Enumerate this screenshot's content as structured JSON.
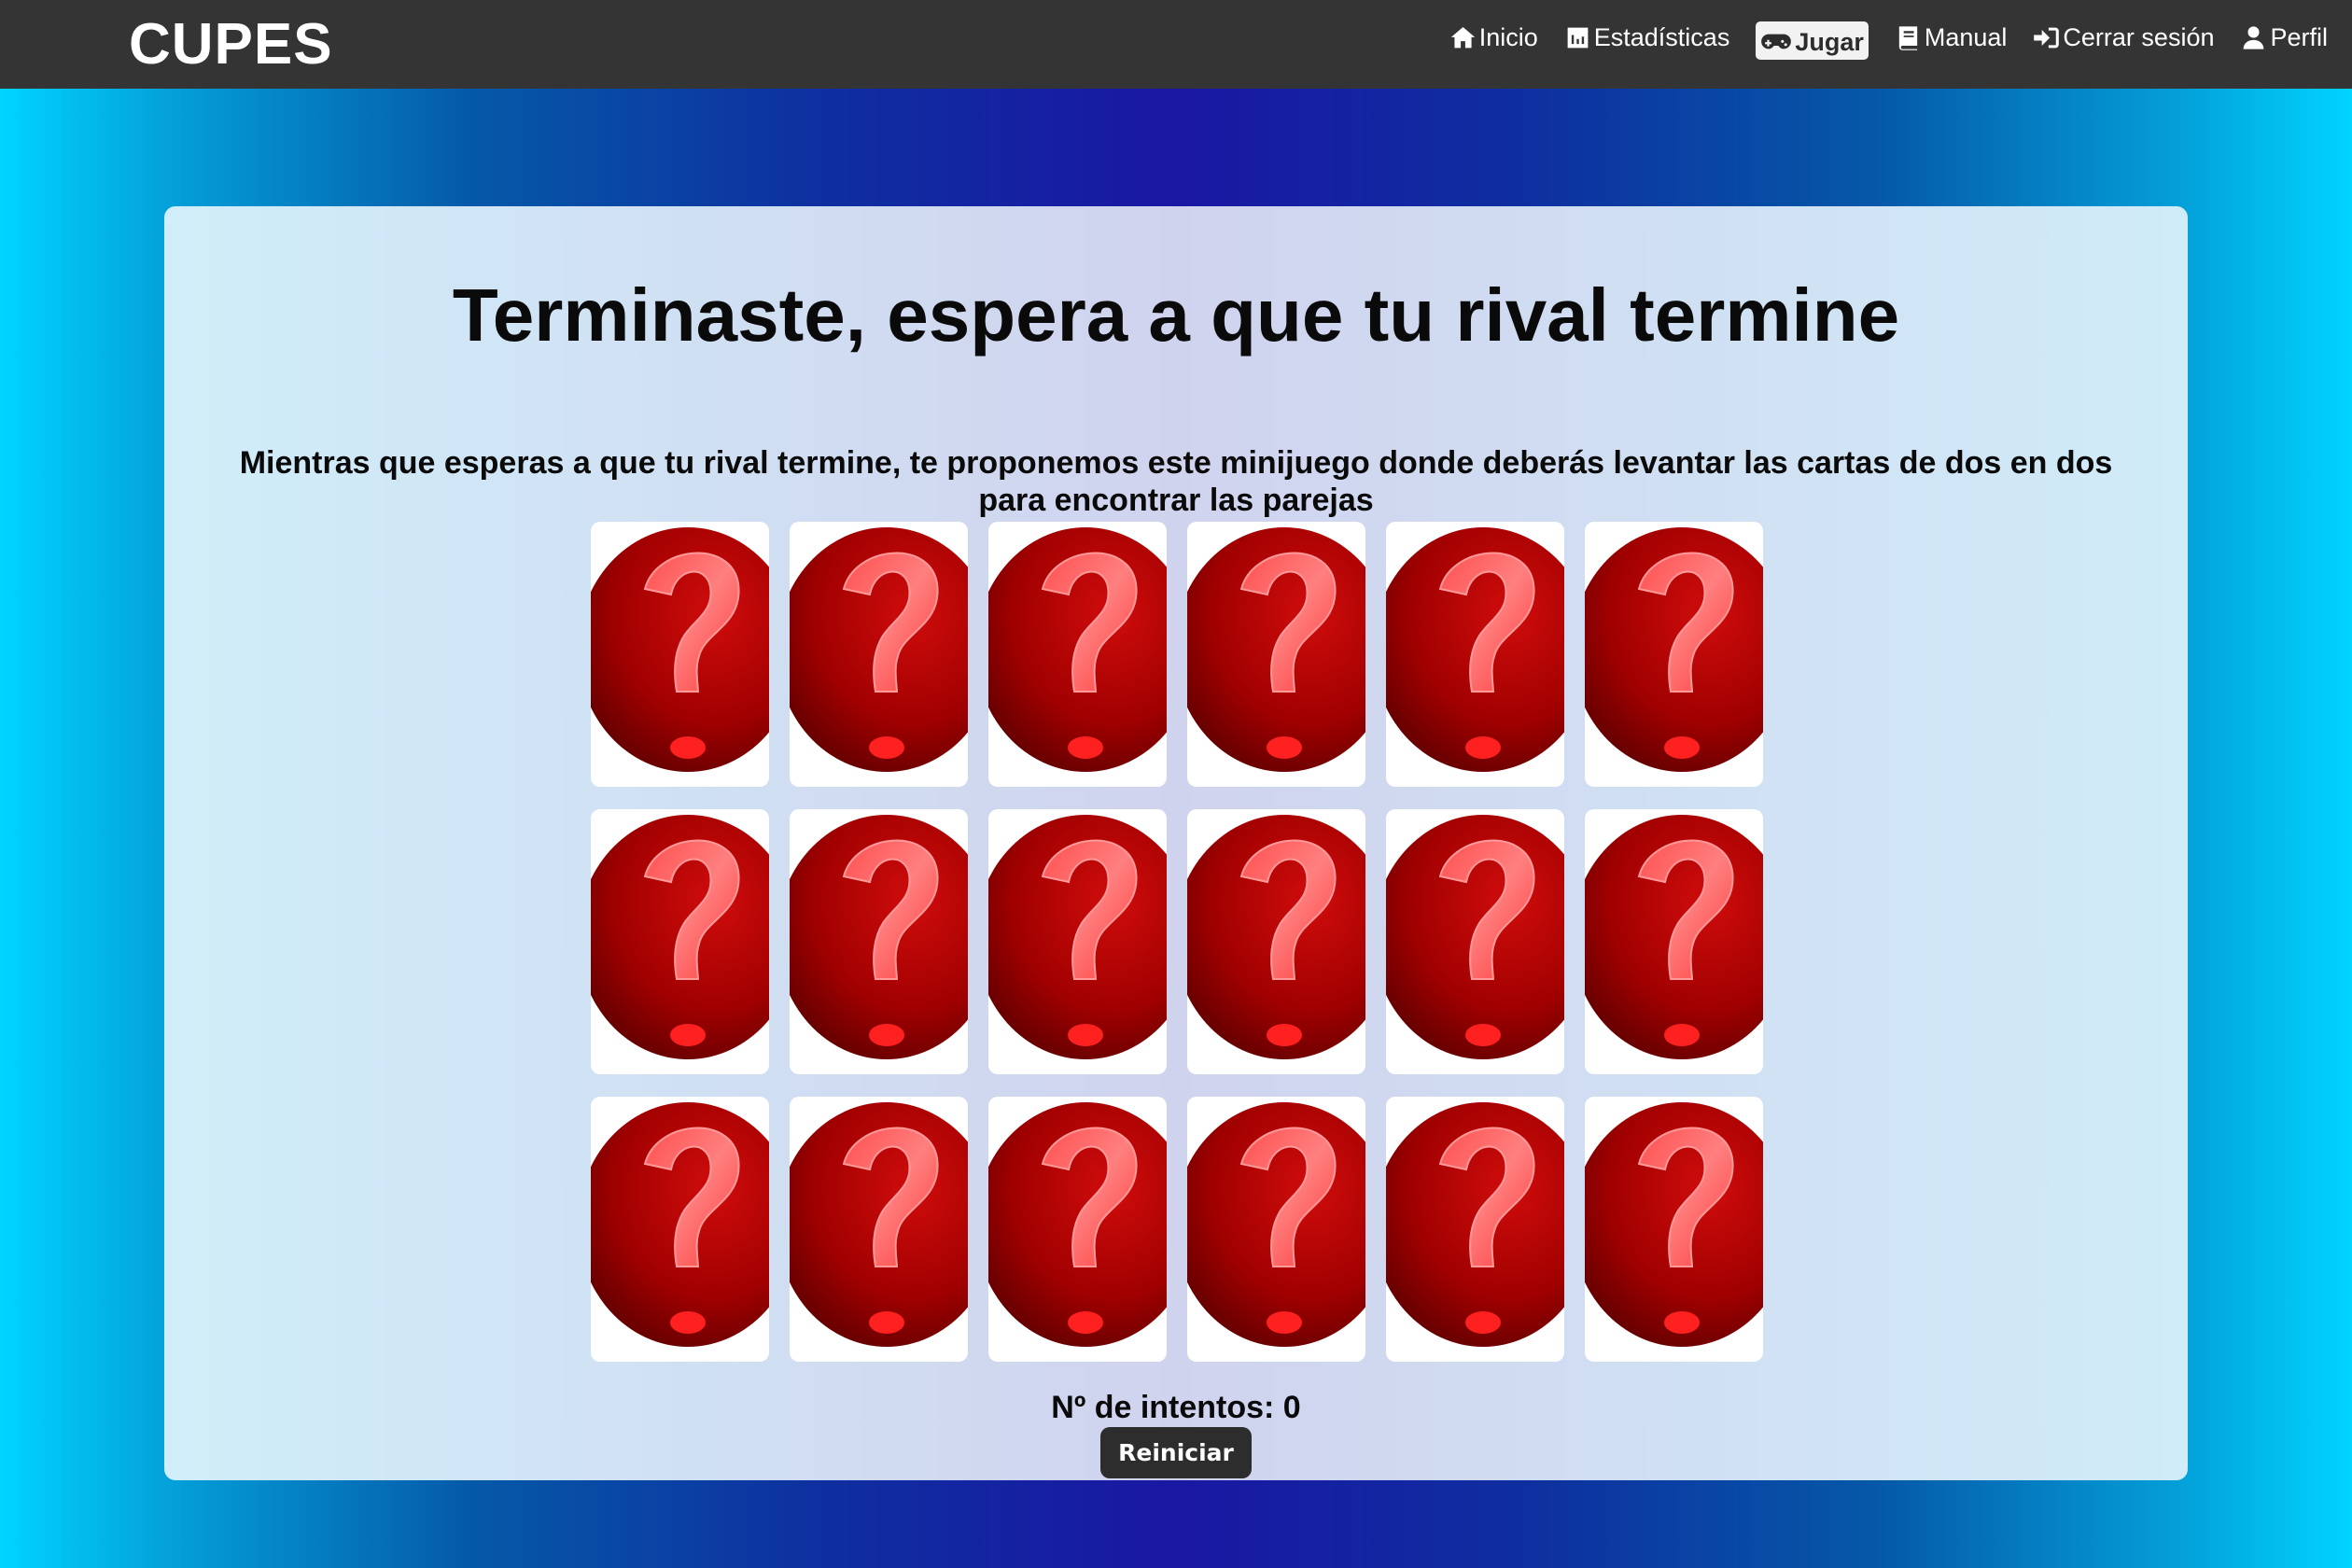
{
  "header": {
    "brand": "CUPES",
    "nav": [
      {
        "label": "Inicio",
        "icon": "home-icon"
      },
      {
        "label": "Estadísticas",
        "icon": "chart-icon"
      },
      {
        "label": "Jugar",
        "icon": "gamepad-icon",
        "active": true
      },
      {
        "label": "Manual",
        "icon": "book-icon"
      },
      {
        "label": "Cerrar sesión",
        "icon": "sign-out-icon"
      },
      {
        "label": "Perfil",
        "icon": "user-icon"
      }
    ]
  },
  "main": {
    "title": "Terminaste, espera a que tu rival termine",
    "instructions": "Mientras que esperas a que tu rival termine, te proponemos este minijuego donde deberás levantar las cartas de dos en dos para encontrar las parejas",
    "game": {
      "rows": 3,
      "columns": 6,
      "card_back_icon": "question-mark-icon",
      "card_color": "#b30000"
    },
    "attempts_label": "Nº de intentos: 0",
    "restart_label": "Reiniciar"
  }
}
